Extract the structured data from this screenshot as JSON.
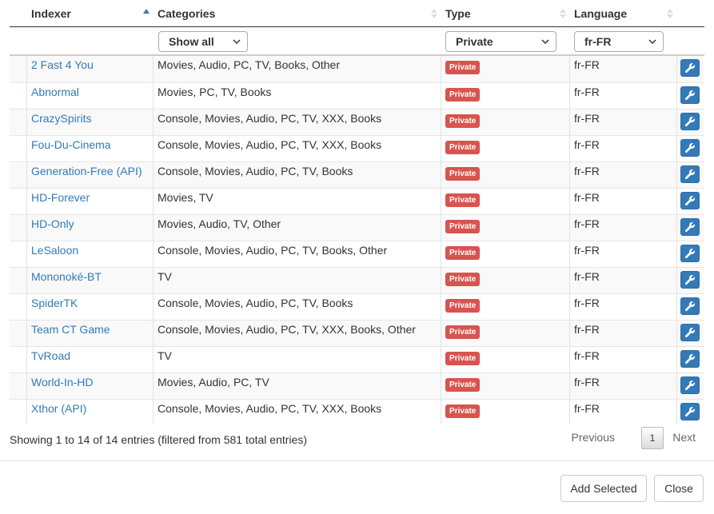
{
  "header": {
    "indexer": "Indexer",
    "categories": "Categories",
    "type": "Type",
    "language": "Language"
  },
  "filters": {
    "categories": "Show all",
    "type": "Private",
    "language": "fr-FR"
  },
  "rows": [
    {
      "name": "2 Fast 4 You",
      "categories": "Movies, Audio, PC, TV, Books, Other",
      "type": "Private",
      "language": "fr-FR"
    },
    {
      "name": "Abnormal",
      "categories": "Movies, PC, TV, Books",
      "type": "Private",
      "language": "fr-FR"
    },
    {
      "name": "CrazySpirits",
      "categories": "Console, Movies, Audio, PC, TV, XXX, Books",
      "type": "Private",
      "language": "fr-FR"
    },
    {
      "name": "Fou-Du-Cinema",
      "categories": "Console, Movies, Audio, PC, TV, XXX, Books",
      "type": "Private",
      "language": "fr-FR"
    },
    {
      "name": "Generation-Free (API)",
      "categories": "Console, Movies, Audio, PC, TV, Books",
      "type": "Private",
      "language": "fr-FR"
    },
    {
      "name": "HD-Forever",
      "categories": "Movies, TV",
      "type": "Private",
      "language": "fr-FR"
    },
    {
      "name": "HD-Only",
      "categories": "Movies, Audio, TV, Other",
      "type": "Private",
      "language": "fr-FR"
    },
    {
      "name": "LeSaloon",
      "categories": "Console, Movies, Audio, PC, TV, Books, Other",
      "type": "Private",
      "language": "fr-FR"
    },
    {
      "name": "Mononoké-BT",
      "categories": "TV",
      "type": "Private",
      "language": "fr-FR"
    },
    {
      "name": "SpiderTK",
      "categories": "Console, Movies, Audio, PC, TV, Books",
      "type": "Private",
      "language": "fr-FR"
    },
    {
      "name": "Team CT Game",
      "categories": "Console, Movies, Audio, PC, TV, XXX, Books, Other",
      "type": "Private",
      "language": "fr-FR"
    },
    {
      "name": "TvRoad",
      "categories": "TV",
      "type": "Private",
      "language": "fr-FR"
    },
    {
      "name": "World-In-HD",
      "categories": "Movies, Audio, PC, TV",
      "type": "Private",
      "language": "fr-FR"
    },
    {
      "name": "Xthor (API)",
      "categories": "Console, Movies, Audio, PC, TV, XXX, Books",
      "type": "Private",
      "language": "fr-FR"
    }
  ],
  "row_action_icon": "wrench-icon",
  "footer_info": "Showing 1 to 14 of 14 entries (filtered from 581 total entries)",
  "pagination": {
    "previous": "Previous",
    "current": "1",
    "next": "Next"
  },
  "buttons": {
    "add_selected": "Add Selected",
    "close": "Close"
  },
  "colors": {
    "link": "#337ab7",
    "badge": "#d9534f",
    "action_button": "#337ab7"
  }
}
